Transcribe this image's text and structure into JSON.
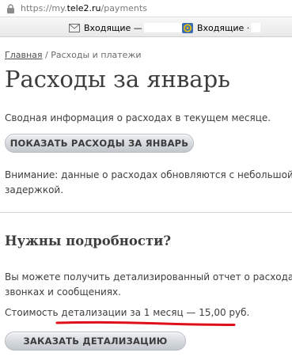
{
  "browser": {
    "url_prefix": "https://my.",
    "url_domain": "tele2.ru",
    "url_path": "/payments"
  },
  "bookmarks": [
    {
      "label": "Входящие —",
      "icon": "mail-icon"
    },
    {
      "label": "Входящие ·",
      "icon": "at-mail-icon"
    }
  ],
  "breadcrumb": {
    "home": "Главная",
    "separator": " / ",
    "current": "Расходы и платежи"
  },
  "page": {
    "title": "Расходы за январь",
    "summary": "Сводная информация о расходах в текущем месяце.",
    "show_button": "ПОКАЗАТЬ РАСХОДЫ ЗА ЯНВАРЬ",
    "warning_line1": "Внимание: данные о расходах обновляются с небольшой",
    "warning_line2": "задержкой."
  },
  "details": {
    "title": "Нужны подробности?",
    "text_line1": "Вы можете получить детализированный отчет о расходах,",
    "text_line2": "звонках и сообщениях.",
    "cost_prefix": "Стоимость ",
    "cost_highlight": "детализации за 1 месяц — 15,00 руб.",
    "order_button": "ЗАКАЗАТЬ ДЕТАЛИЗАЦИЮ"
  },
  "colors": {
    "highlight_underline": "#e0101a"
  }
}
